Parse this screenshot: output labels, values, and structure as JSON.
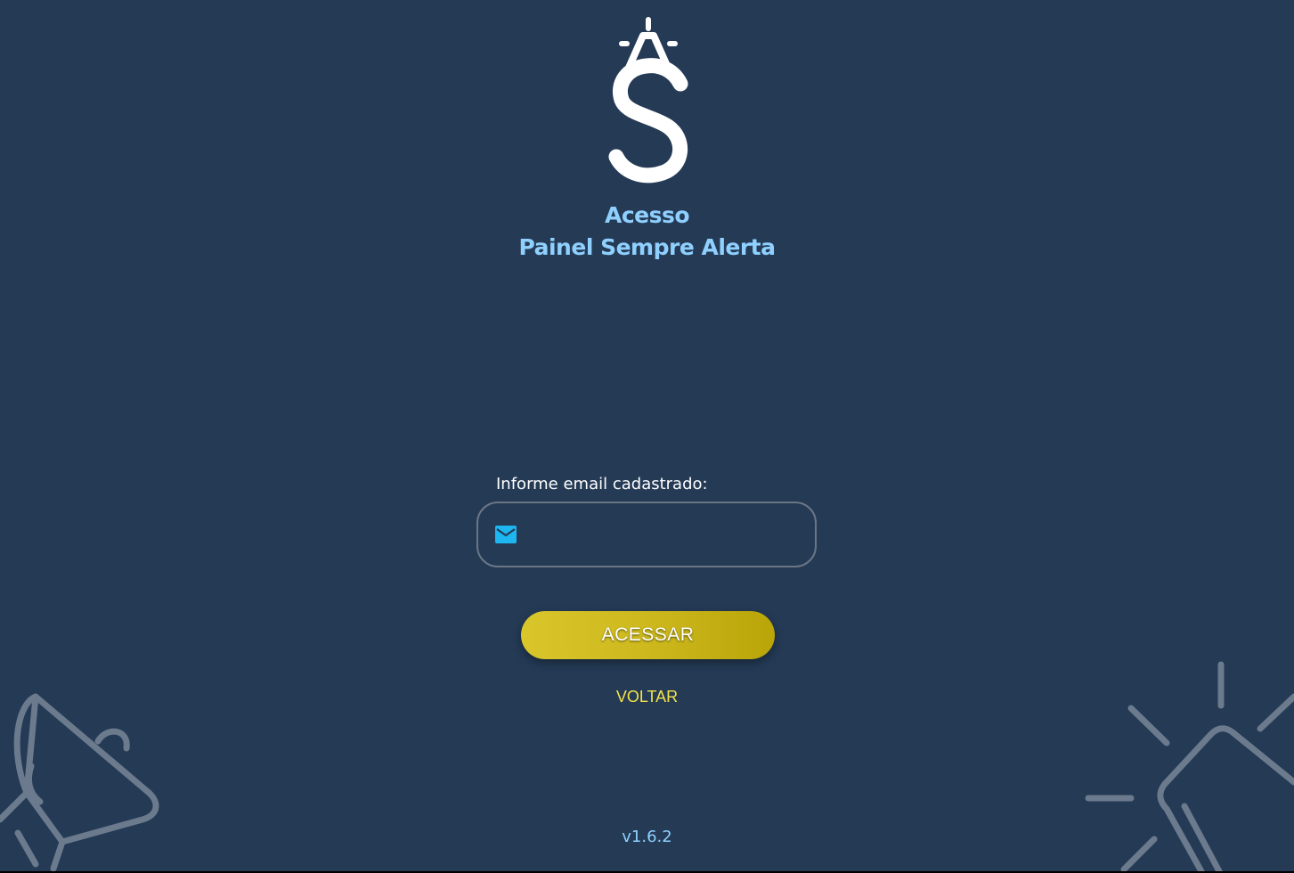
{
  "header": {
    "logo_icon": "sempre-alerta-logo",
    "title_line1": "Acesso",
    "title_line2": "Painel Sempre Alerta"
  },
  "form": {
    "email_label": "Informe email cadastrado:",
    "email_value": "",
    "email_icon": "mail-icon",
    "submit_label": "ACESSAR",
    "back_label": "VOLTAR"
  },
  "footer": {
    "version": "v1.6.2"
  },
  "decorations": {
    "left_icon": "megaphone-icon",
    "right_icon": "siren-light-icon"
  },
  "colors": {
    "background": "#243a55",
    "title": "#8fd0ff",
    "button": "#cdb91e",
    "back_link": "#f3e34a",
    "mail_icon": "#1eb6f0"
  }
}
